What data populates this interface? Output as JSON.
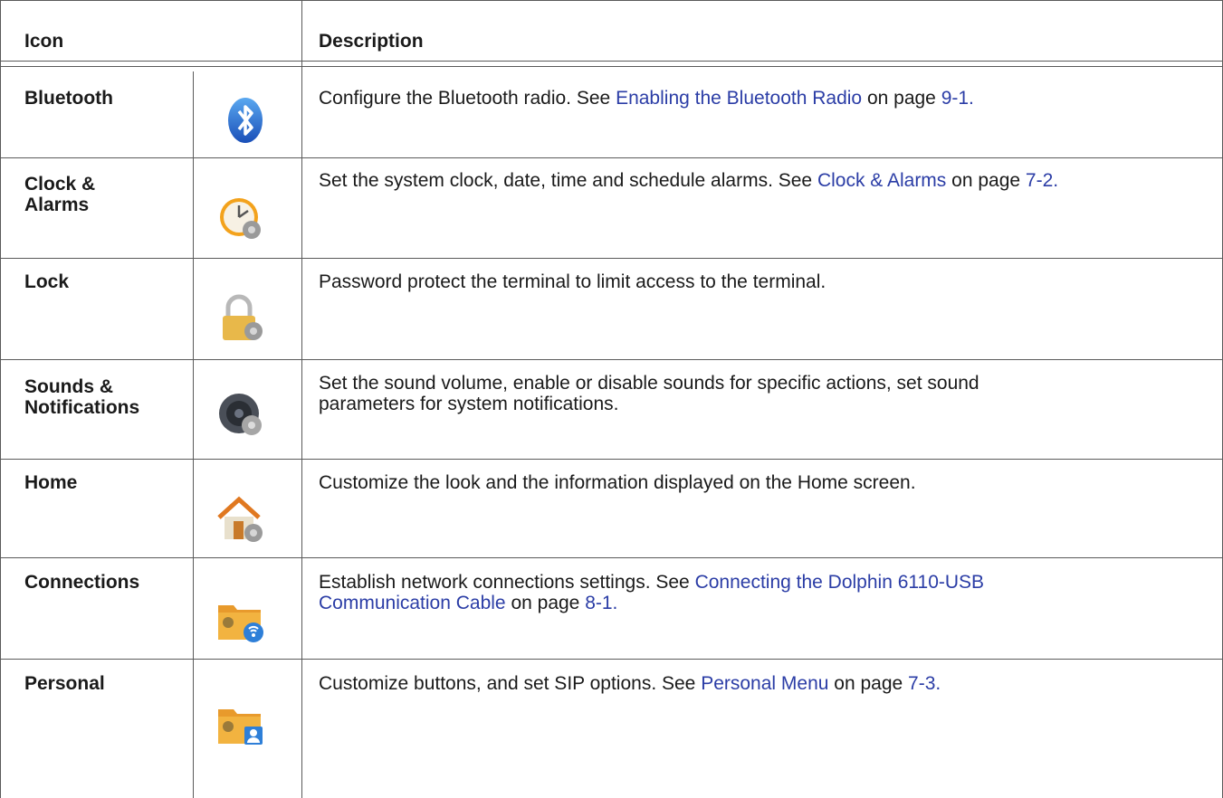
{
  "table": {
    "headers": {
      "icon": "Icon",
      "description": "Description"
    },
    "rows": [
      {
        "name": "Bluetooth",
        "icon": "bluetooth-icon",
        "desc_text": "Configure the Bluetooth radio. See ",
        "link": "Enabling the Bluetooth Radio",
        "desc_mid": " on page ",
        "page": "9-1."
      },
      {
        "name_line1": "Clock &",
        "name_line2": "Alarms",
        "icon": "clock-alarms-icon",
        "desc_text": "Set the system clock, date, time and schedule alarms. See ",
        "link": "Clock & Alarms",
        "desc_mid": " on page ",
        "page": "7-2."
      },
      {
        "name": "Lock",
        "icon": "lock-icon",
        "desc_text": "Password protect the terminal to limit access to the terminal."
      },
      {
        "name_line1": "Sounds &",
        "name_line2": "Notifications",
        "icon": "sounds-notifications-icon",
        "desc_line1": "Set the sound volume, enable or disable sounds for specific actions, set sound",
        "desc_line2": "parameters for system notifications."
      },
      {
        "name": "Home",
        "icon": "home-icon",
        "desc_text": "Customize the look and the information displayed on the Home screen."
      },
      {
        "name": "Connections",
        "icon": "connections-folder-icon",
        "desc_text": "Establish network connections settings. See ",
        "link_line1": "Connecting the Dolphin 6110-USB",
        "link_line2": "Communication Cable",
        "desc_mid": " on page ",
        "page": "8-1."
      },
      {
        "name": "Personal",
        "icon": "personal-folder-icon",
        "desc_text": "Customize buttons, and set SIP options. See ",
        "link": "Personal Menu",
        "desc_mid": " on page ",
        "page": "7-3."
      }
    ]
  },
  "colors": {
    "link": "#2b3da6",
    "rule": "#5a5a5a",
    "text": "#1a1a1a"
  }
}
